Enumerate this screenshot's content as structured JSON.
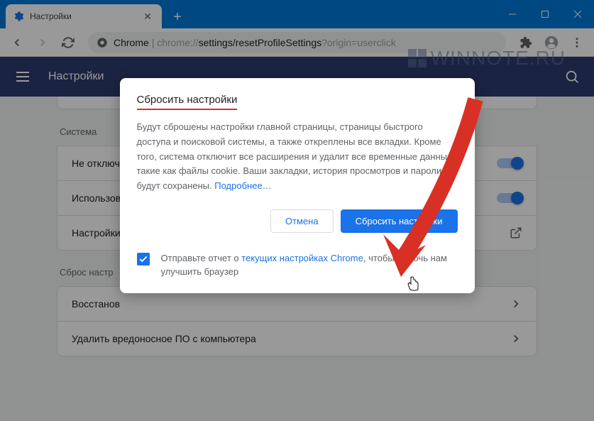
{
  "titlebar": {
    "tab_title": "Настройки"
  },
  "toolbar": {
    "url_prefix": "Chrome",
    "url_scheme": "chrome://",
    "url_path": "settings/resetProfileSettings",
    "url_query": "?origin=userclick"
  },
  "header": {
    "title": "Настройки"
  },
  "sections": {
    "system_label": "Система",
    "reset_label": "Сброс настр",
    "rows": {
      "no_disable": "Не отключ",
      "use": "Использов",
      "settings": "Настройки",
      "restore": "Восстанов",
      "remove_malware": "Удалить вредоносное ПО с компьютера"
    }
  },
  "modal": {
    "title": "Сбросить настройки",
    "text": "Будут сброшены настройки главной страницы, страницы быстрого доступа и поисковой системы, а также откреплены все вкладки. Кроме того, система отключит все расширения и удалит все временные данные, такие как файлы cookie. Ваши закладки, история просмотров и пароли будут сохранены.",
    "learn_more": "Подробнее…",
    "cancel": "Отмена",
    "confirm": "Сбросить настройки",
    "report_prefix": "Отправьте отчет о ",
    "report_link": "текущих настройках Chrome",
    "report_suffix": ", чтобы помочь нам улучшить браузер"
  },
  "watermark": "WINNOTE.RU"
}
